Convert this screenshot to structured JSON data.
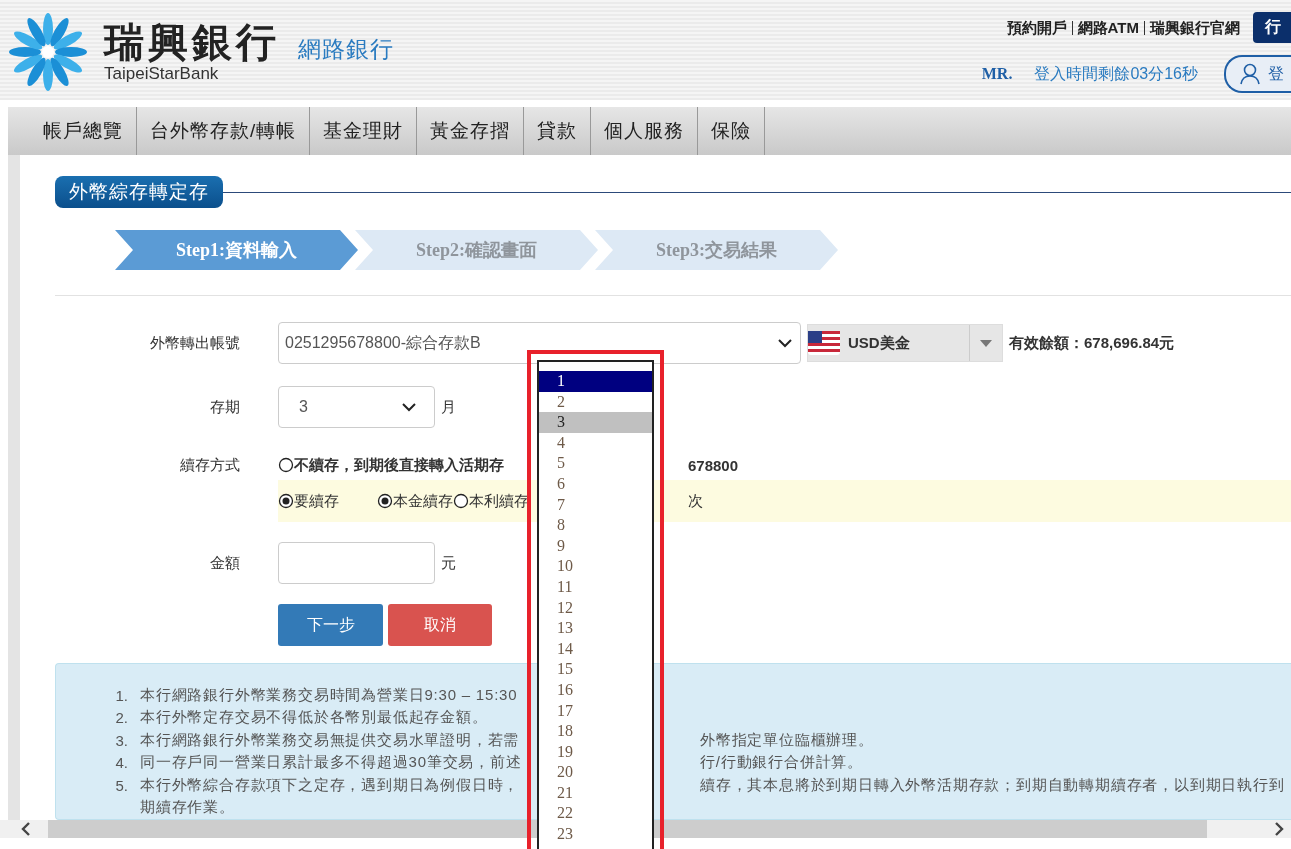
{
  "header": {
    "bank_name": "瑞興銀行",
    "bank_name_en": "TaipeiStarBank",
    "service": "網路銀行",
    "links": [
      "預約開戶",
      "網路ATM",
      "瑞興銀行官網"
    ],
    "mobile_button": "行",
    "user": "MR.",
    "session": "登入時間剩餘03分16秒",
    "account_button": "登"
  },
  "nav": [
    "帳戶總覽",
    "台外幣存款/轉帳",
    "基金理財",
    "黃金存摺",
    "貸款",
    "個人服務",
    "保險"
  ],
  "section_title": "外幣綜存轉定存",
  "steps": [
    {
      "label": "Step1:資料輸入",
      "selected": true
    },
    {
      "label": "Step2:確認畫面",
      "selected": false
    },
    {
      "label": "Step3:交易結果",
      "selected": false
    }
  ],
  "form": {
    "account": {
      "label": "外幣轉出帳號",
      "value": "0251295678800-綜合存款B",
      "currency": "USD美金",
      "balance": "有效餘額：678,696.84元"
    },
    "term": {
      "label": "存期",
      "value": "3",
      "unit": "月"
    },
    "renewal": {
      "label": "續存方式",
      "no_renew": {
        "selected": false,
        "segments": [
          "不續存，到期後直接轉入活期存",
          "678800"
        ]
      },
      "renew": {
        "selected": true,
        "label": "要續存"
      },
      "modes": [
        {
          "label": "本金續存",
          "selected": true
        },
        {
          "label": "本利續存",
          "selected": false
        }
      ],
      "tail": "次"
    },
    "amount": {
      "label": "金額",
      "unit": "元"
    },
    "buttons": [
      {
        "kind": "primary",
        "label": "下一步"
      },
      {
        "kind": "danger",
        "label": "取消"
      }
    ]
  },
  "notes": [
    {
      "number": "1.",
      "lines": [
        [
          "本行網路銀行外幣業務交易時間為營業日9:30 – 15:30"
        ]
      ]
    },
    {
      "number": "2.",
      "lines": [
        [
          "本行外幣定存交易不得低於各幣別最低起存金額。"
        ]
      ]
    },
    {
      "number": "3.",
      "lines": [
        [
          "本行網路銀行外幣業務交易無提供交易水單證明，若需",
          "外幣指定單位臨櫃辦理。"
        ]
      ]
    },
    {
      "number": "4.",
      "lines": [
        [
          "同一存戶同一營業日累計最多不得超過30筆交易，前述",
          "行/行動銀行合併計算。"
        ]
      ]
    },
    {
      "number": "5.",
      "lines": [
        [
          "本行外幣綜合存款項下之定存，遇到期日為例假日時，",
          "續存，其本息將於到期日轉入外幣活期存款；到期自動轉期續存者，以到期日執行到"
        ],
        [
          "期續存作業。"
        ]
      ]
    }
  ],
  "dropdown": {
    "options": [
      {
        "label": "1",
        "highlighted": true,
        "selected": false
      },
      {
        "label": "2",
        "highlighted": false,
        "selected": false
      },
      {
        "label": "3",
        "highlighted": false,
        "selected": true
      },
      {
        "label": "4",
        "highlighted": false,
        "selected": false
      },
      {
        "label": "5",
        "highlighted": false,
        "selected": false
      },
      {
        "label": "6",
        "highlighted": false,
        "selected": false
      },
      {
        "label": "7",
        "highlighted": false,
        "selected": false
      },
      {
        "label": "8",
        "highlighted": false,
        "selected": false
      },
      {
        "label": "9",
        "highlighted": false,
        "selected": false
      },
      {
        "label": "10",
        "highlighted": false,
        "selected": false
      },
      {
        "label": "11",
        "highlighted": false,
        "selected": false
      },
      {
        "label": "12",
        "highlighted": false,
        "selected": false
      },
      {
        "label": "13",
        "highlighted": false,
        "selected": false
      },
      {
        "label": "14",
        "highlighted": false,
        "selected": false
      },
      {
        "label": "15",
        "highlighted": false,
        "selected": false
      },
      {
        "label": "16",
        "highlighted": false,
        "selected": false
      },
      {
        "label": "17",
        "highlighted": false,
        "selected": false
      },
      {
        "label": "18",
        "highlighted": false,
        "selected": false
      },
      {
        "label": "19",
        "highlighted": false,
        "selected": false
      },
      {
        "label": "20",
        "highlighted": false,
        "selected": false
      },
      {
        "label": "21",
        "highlighted": false,
        "selected": false
      },
      {
        "label": "22",
        "highlighted": false,
        "selected": false
      },
      {
        "label": "23",
        "highlighted": false,
        "selected": false
      }
    ]
  }
}
